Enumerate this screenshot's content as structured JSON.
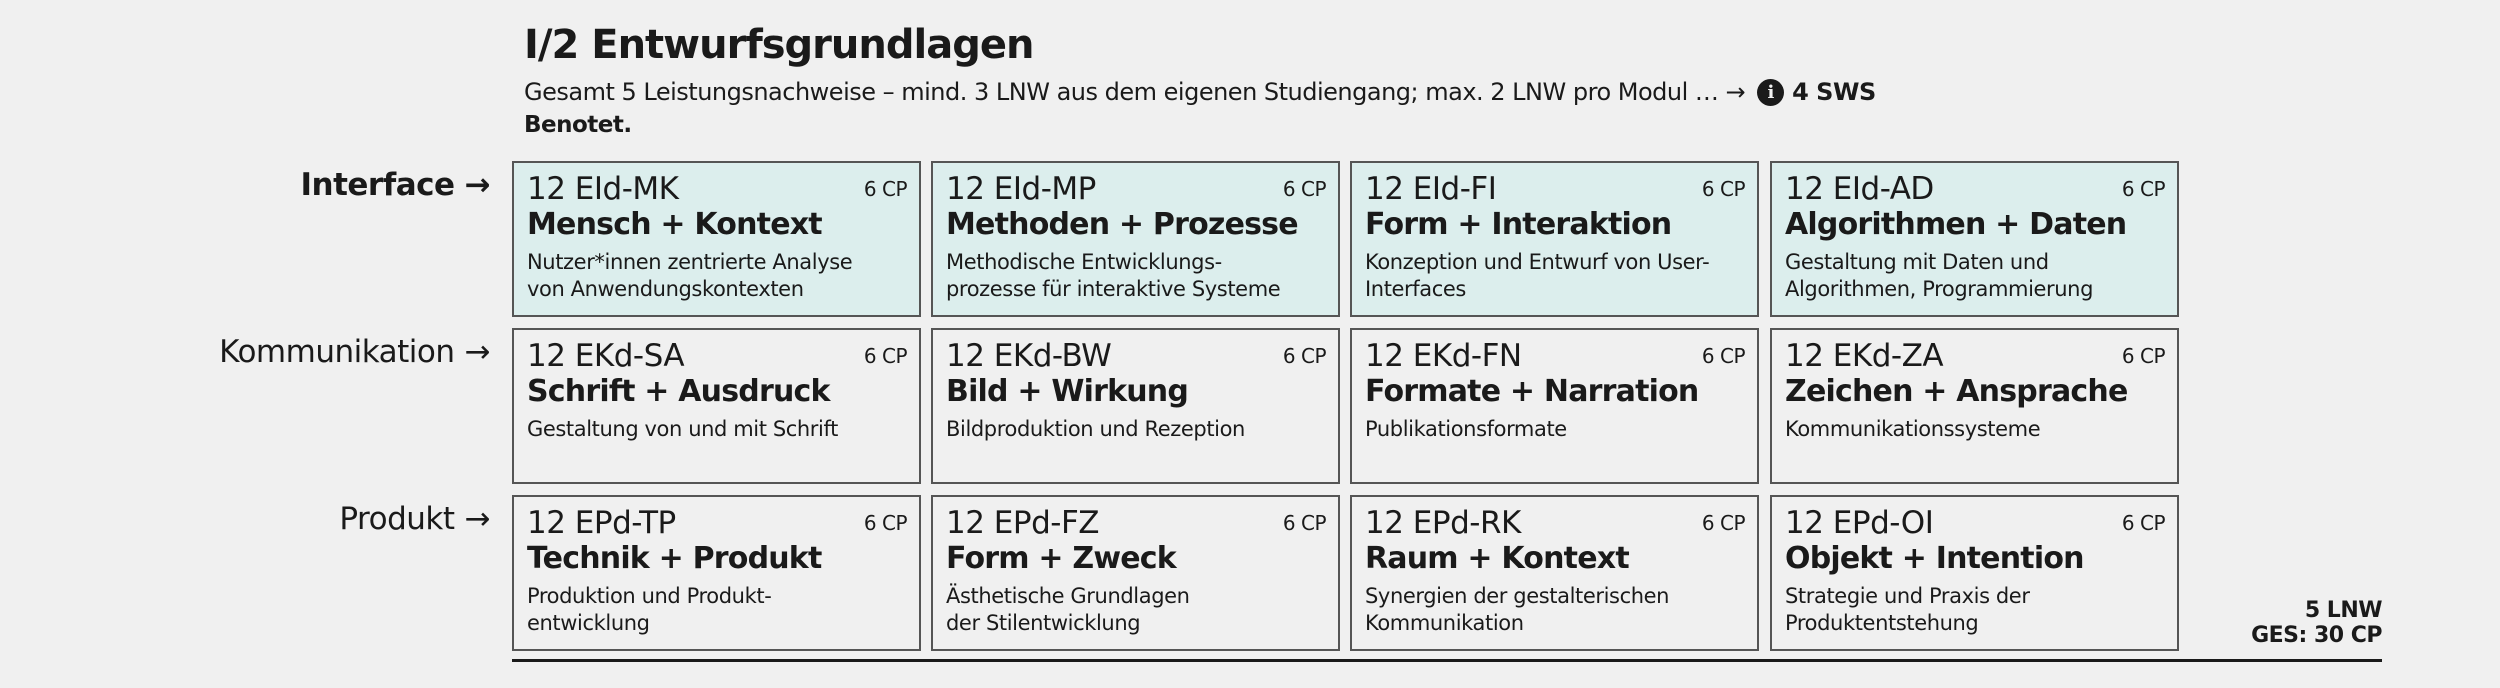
{
  "header": {
    "title": "I/2 Entwurfsgrundlagen",
    "subtitle": "Gesamt 5 Leistungsnachweise – mind. 3 LNW aus dem eigenen Studiengang; max. 2 LNW pro Modul … →",
    "info_icon_glyph": "i",
    "sws": "4 SWS",
    "graded": "Benotet."
  },
  "arrow_glyph": "→",
  "rows": [
    {
      "label": "Interface",
      "highlighted": true,
      "modules": [
        {
          "code": "12 EId-MK",
          "cp": "6 CP",
          "name": "Mensch + Kontext",
          "desc": "Nutzer*innen zentrierte Analyse\nvon Anwendungskontexten"
        },
        {
          "code": "12 EId-MP",
          "cp": "6 CP",
          "name": "Methoden + Prozesse",
          "desc": "Methodische Entwicklungs-\nprozesse für interaktive Systeme"
        },
        {
          "code": "12 EId-FI",
          "cp": "6 CP",
          "name": "Form + Interaktion",
          "desc": "Konzeption und Entwurf von User-\nInterfaces"
        },
        {
          "code": "12 EId-AD",
          "cp": "6 CP",
          "name": "Algorithmen + Daten",
          "desc": "Gestaltung mit Daten und\nAlgorithmen, Programmierung"
        }
      ]
    },
    {
      "label": "Kommunikation",
      "highlighted": false,
      "modules": [
        {
          "code": "12 EKd-SA",
          "cp": "6 CP",
          "name": "Schrift + Ausdruck",
          "desc": "Gestaltung von und mit Schrift"
        },
        {
          "code": "12 EKd-BW",
          "cp": "6 CP",
          "name": "Bild + Wirkung",
          "desc": "Bildproduktion und Rezeption"
        },
        {
          "code": "12 EKd-FN",
          "cp": "6 CP",
          "name": "Formate + Narration",
          "desc": "Publikationsformate"
        },
        {
          "code": "12 EKd-ZA",
          "cp": "6 CP",
          "name": "Zeichen + Ansprache",
          "desc": "Kommunikationssysteme"
        }
      ]
    },
    {
      "label": "Produkt",
      "highlighted": false,
      "modules": [
        {
          "code": "12 EPd-TP",
          "cp": "6 CP",
          "name": "Technik + Produkt",
          "desc": "Produktion und Produkt-\nentwicklung"
        },
        {
          "code": "12 EPd-FZ",
          "cp": "6 CP",
          "name": "Form + Zweck",
          "desc": "Ästhetische Grundlagen\nder Stilentwicklung"
        },
        {
          "code": "12 EPd-RK",
          "cp": "6 CP",
          "name": "Raum + Kontext",
          "desc": "Synergien der gestalterischen\nKommunikation"
        },
        {
          "code": "12 EPd-OI",
          "cp": "6 CP",
          "name": "Objekt + Intention",
          "desc": "Strategie und Praxis der\nProduktentstehung"
        }
      ]
    }
  ],
  "summary": {
    "lnw": "5 LNW",
    "total": "GES: 30 CP"
  },
  "colors": {
    "background": "#f0f0f0",
    "highlight": "#dceeed",
    "border": "#555555",
    "text": "#1a1a1a"
  }
}
